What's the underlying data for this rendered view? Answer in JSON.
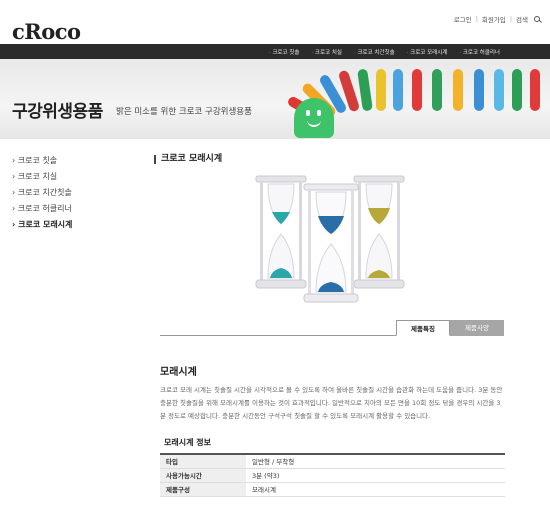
{
  "brand": {
    "logo": "cRoco"
  },
  "util_nav": {
    "login": "로그인",
    "join": "회원가입",
    "search": "검색"
  },
  "gnb": {
    "items": [
      "크로코 칫솔",
      "크로코 치실",
      "크로코 치간칫솔",
      "크로코 모래시계",
      "크로코 허클리너"
    ]
  },
  "banner": {
    "title": "구강위생용품",
    "subtitle": "밝은 미소를 위한 크로코 구강위생용품"
  },
  "sidebar": {
    "items": [
      "크로코 칫솔",
      "크로코 치실",
      "크로코 치간칫솔",
      "크로코 허클리너",
      "크로코 모래시계"
    ],
    "active_index": 4
  },
  "main": {
    "title": "크로코 모래시계",
    "tabs": [
      "제품특징",
      "제품사양"
    ],
    "active_tab": 0,
    "section_title": "모래시계",
    "description": "크로코 모래 시계는 칫솔질 시간을 시각적으로 볼 수 있도록 하여 올바른 칫솔질 시간을 습관화 하는데 도움을 줍니다. 3분 동안 충분한 칫솔질을 위해 모래시계를 이용하는 것이 효과적입니다. 일반적으로 치아의 모든 면을 10회 정도 닦을 경우의 시간을 3분 정도로 예상합니다. 충분한 시간동안 구석구석 칫솔질 할 수 있도록 모래시계 활용할 수 있습니다.",
    "info_title": "모래시계 정보",
    "specs": [
      {
        "label": "타입",
        "value": "일반형 / 부착형"
      },
      {
        "label": "사용가능시간",
        "value": "3분 (약3)"
      },
      {
        "label": "제품구성",
        "value": "모래시계"
      }
    ]
  },
  "colors": {
    "gnb_bg": "#2b2b2b",
    "sand_teal": "#2aa7a8",
    "sand_blue": "#2a6ea8",
    "sand_olive": "#b6a93a",
    "mascot": "#3ec26a"
  }
}
